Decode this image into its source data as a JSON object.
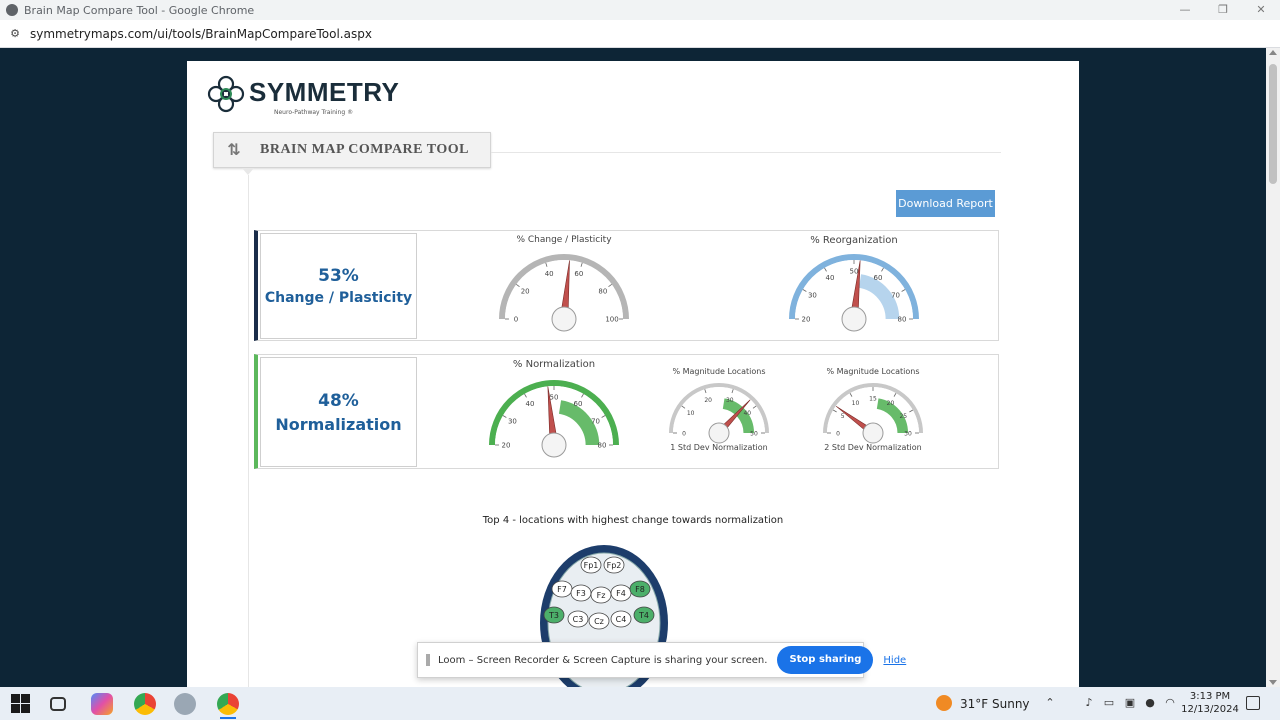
{
  "browser": {
    "window_title": "Brain Map Compare Tool - Google Chrome",
    "url": "symmetrymaps.com/ui/tools/BrainMapCompareTool.aspx"
  },
  "logo": {
    "name": "SYMMETRY",
    "tagline": "Neuro-Pathway Training ®"
  },
  "tool": {
    "title": "BRAIN MAP COMPARE TOOL",
    "download_label": "Download Report"
  },
  "panel_change": {
    "percent": "53%",
    "label": "Change / Plasticity",
    "gauges": [
      {
        "title": "% Change / Plasticity",
        "ticks": [
          "0",
          "20",
          "40",
          "60",
          "80",
          "100"
        ],
        "value": 53,
        "min": 0,
        "max": 100,
        "color": "#b5b5b5",
        "band_color": "#ffffff"
      },
      {
        "title": "% Reorganization",
        "ticks": [
          "20",
          "30",
          "40",
          "50",
          "60",
          "70",
          "80"
        ],
        "value": 52,
        "min": 20,
        "max": 80,
        "color": "#7fb2dd",
        "band_color": "#a9cdea"
      }
    ]
  },
  "panel_norm": {
    "percent": "48%",
    "label": "Normalization",
    "gauges": [
      {
        "title": "% Normalization",
        "ticks": [
          "20",
          "30",
          "40",
          "50",
          "60",
          "70",
          "80"
        ],
        "value": 48,
        "min": 20,
        "max": 80,
        "color": "#4caf50",
        "band_color": "#4caf50"
      },
      {
        "title": "% Magnitude Locations",
        "caption": "1 Std Dev Normalization",
        "ticks": [
          "0",
          "10",
          "20",
          "30",
          "40",
          "50"
        ],
        "value": 37,
        "min": 0,
        "max": 50,
        "color": "#c8c8c8",
        "band_color": "#4caf50"
      },
      {
        "title": "% Magnitude Locations",
        "caption": "2 Std Dev Normalization",
        "ticks": [
          "0",
          "5",
          "10",
          "15",
          "20",
          "25",
          "30"
        ],
        "value": 6,
        "min": 0,
        "max": 30,
        "color": "#c8c8c8",
        "band_color": "#4caf50"
      }
    ]
  },
  "top4": {
    "title": "Top 4 - locations with highest change towards normalization",
    "electrodes": [
      {
        "label": "Fp1",
        "highlight": false
      },
      {
        "label": "Fp2",
        "highlight": false
      },
      {
        "label": "F7",
        "highlight": false
      },
      {
        "label": "F3",
        "highlight": false
      },
      {
        "label": "Fz",
        "highlight": false
      },
      {
        "label": "F4",
        "highlight": false
      },
      {
        "label": "F8",
        "highlight": true
      },
      {
        "label": "T3",
        "highlight": true
      },
      {
        "label": "C3",
        "highlight": false
      },
      {
        "label": "Cz",
        "highlight": false
      },
      {
        "label": "C4",
        "highlight": false
      },
      {
        "label": "T4",
        "highlight": true
      }
    ]
  },
  "loom": {
    "message": "Loom – Screen Recorder & Screen Capture is sharing your screen.",
    "stop_label": "Stop sharing",
    "hide_label": "Hide"
  },
  "taskbar": {
    "weather": "31°F  Sunny",
    "time": "3:13 PM",
    "date": "12/13/2024"
  }
}
